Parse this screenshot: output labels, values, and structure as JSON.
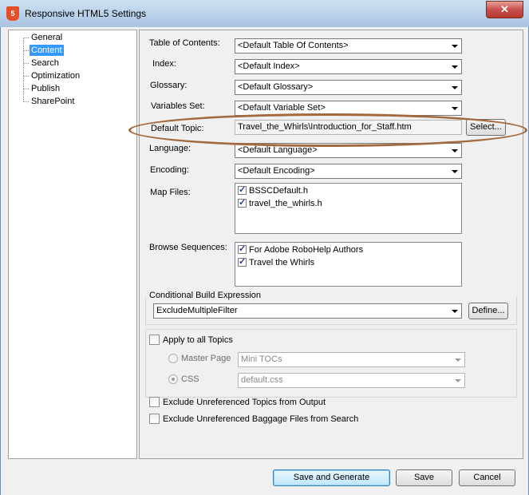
{
  "window": {
    "title": "Responsive HTML5 Settings",
    "close_glyph": "✕",
    "app_icon": "html5-icon"
  },
  "tree": {
    "items": [
      {
        "label": "General",
        "selected": false
      },
      {
        "label": "Content",
        "selected": true
      },
      {
        "label": "Search",
        "selected": false
      },
      {
        "label": "Optimization",
        "selected": false
      },
      {
        "label": "Publish",
        "selected": false
      },
      {
        "label": "SharePoint",
        "selected": false
      }
    ]
  },
  "content": {
    "toc": {
      "label": "Table of Contents:",
      "value": "<Default Table Of Contents>"
    },
    "index": {
      "label": "Index:",
      "value": "<Default Index>"
    },
    "glossary": {
      "label": "Glossary:",
      "value": "<Default Glossary>"
    },
    "variables": {
      "label": "Variables Set:",
      "value": "<Default Variable Set>"
    },
    "default_topic": {
      "label": "Default Topic:",
      "value": "Travel_the_Whirls\\Introduction_for_Staff.htm",
      "select_label": "Select..."
    },
    "language": {
      "label": "Language:",
      "value": "<Default Language>"
    },
    "encoding": {
      "label": "Encoding:",
      "value": "<Default Encoding>"
    },
    "map_files": {
      "label": "Map Files:",
      "items": [
        {
          "label": "BSSCDefault.h",
          "checked": true
        },
        {
          "label": "travel_the_whirls.h",
          "checked": true
        }
      ]
    },
    "browse_sequences": {
      "label": "Browse Sequences:",
      "items": [
        {
          "label": "For Adobe RoboHelp Authors",
          "checked": true
        },
        {
          "label": "Travel the Whirls",
          "checked": true
        }
      ]
    },
    "conditional": {
      "label": "Conditional Build Expression",
      "value": "ExcludeMultipleFilter",
      "define_label": "Define..."
    },
    "apply_all": {
      "label": "Apply to all Topics",
      "checked": false
    },
    "master_page": {
      "label": "Master Page",
      "value": "Mini TOCs",
      "selected": false
    },
    "css": {
      "label": "CSS",
      "value": "default.css",
      "selected": true
    },
    "exclude_topics": {
      "label": "Exclude Unreferenced Topics from Output",
      "checked": false
    },
    "exclude_baggage": {
      "label": "Exclude Unreferenced Baggage Files from Search",
      "checked": false
    }
  },
  "footer": {
    "save_generate": "Save and Generate",
    "save": "Save",
    "cancel": "Cancel"
  },
  "colors": {
    "selection": "#3399ff",
    "annotation_oval": "#a1693d"
  }
}
